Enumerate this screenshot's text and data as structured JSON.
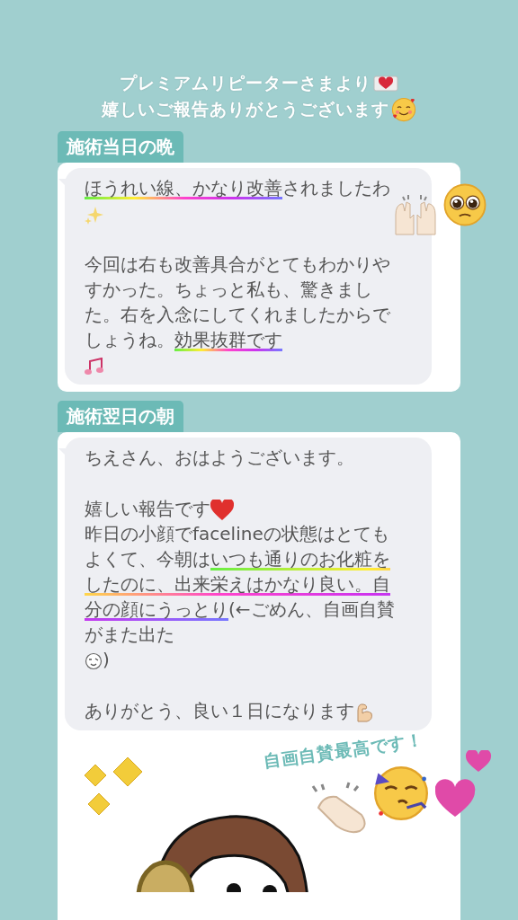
{
  "header": {
    "lines": [
      "プレミアムリピーターさまより",
      "嬉しいご報告ありがとうございます"
    ]
  },
  "sections": [
    {
      "label": "施術当日の晩",
      "message": {
        "paragraphs": [
          [
            "**ほうれい線、かなり改善**されましたわ"
          ],
          [
            "今回は右も改善具合がとてもわかりやすかった。ちょっと私も、驚きました。右を入念にしてくれましたからでしょうね。**効果抜群です**"
          ]
        ]
      }
    },
    {
      "label": "施術翌日の朝",
      "message": {
        "paragraphs": [
          [
            "ちえさん、おはようございます。"
          ],
          [
            "嬉しい報告です"
          ],
          [
            "昨日の小顔でfacelineの状態はとてもよくて、今朝は**いつも通りのお化粧をしたのに、出来栄えはかなり良い。自分の顔にうっとり**(←ごめん、自画自賛がまた出た",
            ")"
          ],
          [
            "ありがとう、良い１日になります"
          ]
        ]
      },
      "sticker": {
        "caption": "自画自賛最高です！"
      }
    }
  ]
}
